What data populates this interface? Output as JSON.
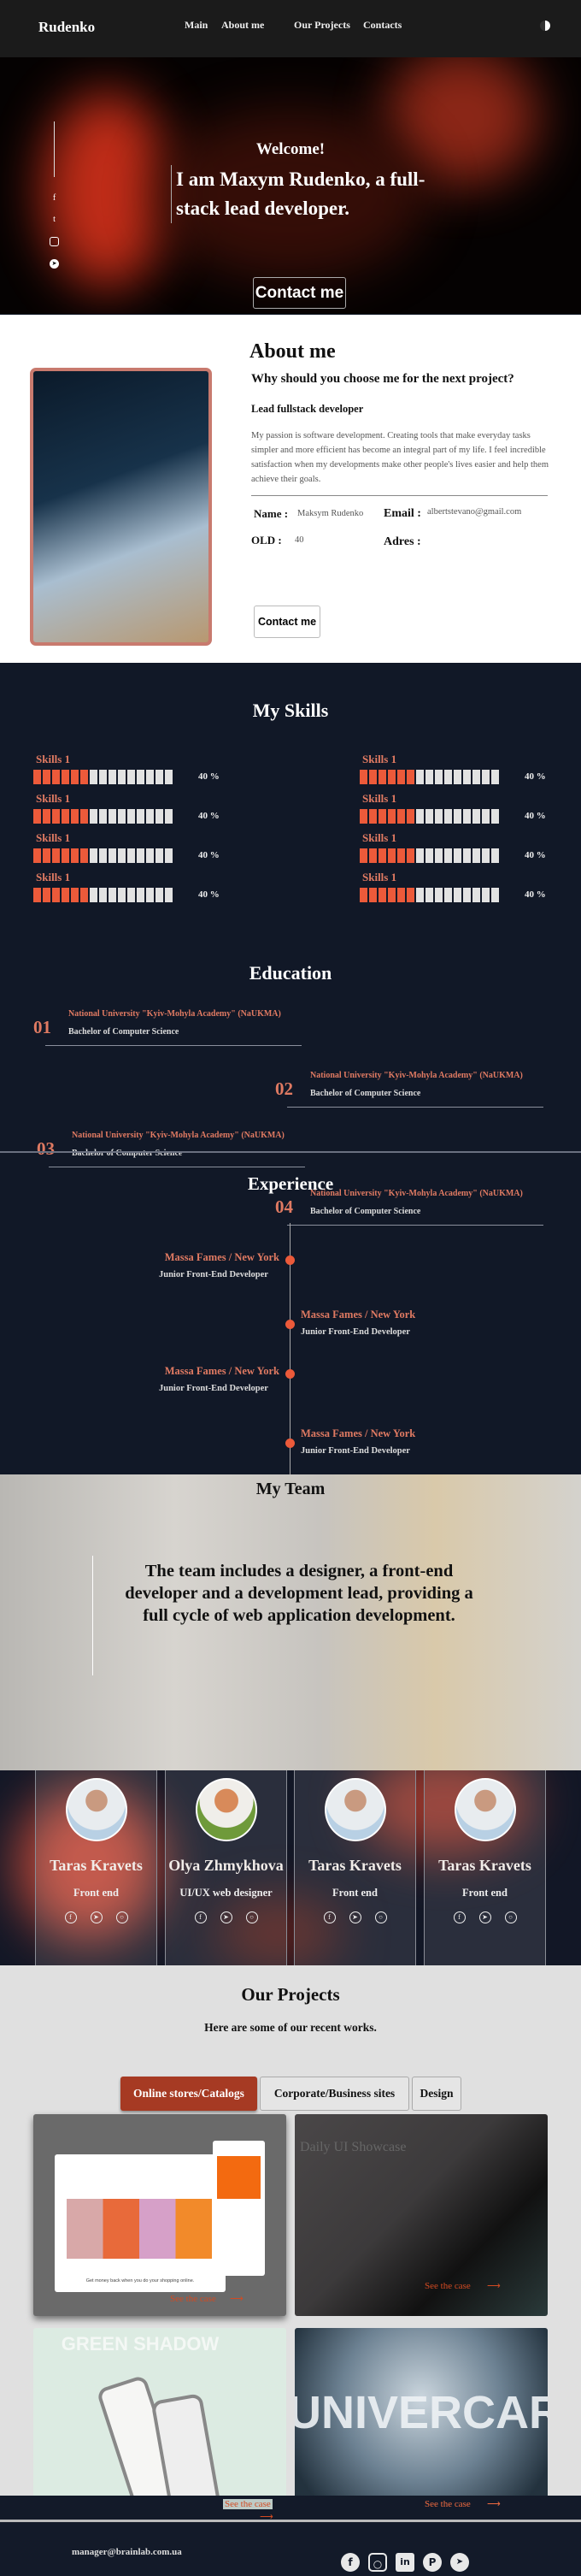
{
  "header": {
    "logo": "Rudenko",
    "nav": [
      "Main",
      "About me",
      "Our Projects",
      "Contacts"
    ],
    "theme_icon": "half-moon-toggle"
  },
  "hero": {
    "welcome": "Welcome!",
    "headline": "I am Maxym Rudenko, a full-stack lead developer.",
    "button": "Contact me",
    "socials": [
      "facebook",
      "twitter",
      "instagram",
      "telegram"
    ],
    "accent": "#e8381f"
  },
  "about": {
    "title": "About me",
    "question": "Why should you choose me for the next project?",
    "role": "Lead fullstack developer",
    "description": "My passion is software development. Creating tools that make everyday tasks simpler and more efficient has become an integral part of my life. I feel incredible satisfaction when my developments make other people's lives easier and help them achieve their goals.",
    "name_label": "Name :",
    "name": "Maksym Rudenko",
    "email_label": "Email :",
    "email": "albertstevano@gmail.com",
    "old_label": "OLD :",
    "old": "40",
    "address_label": "Adres :",
    "button": "Contact me"
  },
  "skills": {
    "title": "My Skills",
    "items": [
      {
        "label": "Skills 1",
        "percent": 40,
        "text": "40 %"
      },
      {
        "label": "Skills 1",
        "percent": 40,
        "text": "40 %"
      },
      {
        "label": "Skills 1",
        "percent": 40,
        "text": "40 %"
      },
      {
        "label": "Skills 1",
        "percent": 40,
        "text": "40 %"
      },
      {
        "label": "Skills 1",
        "percent": 40,
        "text": "40 %"
      },
      {
        "label": "Skills 1",
        "percent": 40,
        "text": "40 %"
      },
      {
        "label": "Skills 1",
        "percent": 40,
        "text": "40 %"
      },
      {
        "label": "Skills 1",
        "percent": 40,
        "text": "40 %"
      }
    ],
    "fill_color": "#ec5a3a",
    "empty_color": "#e2e2e2"
  },
  "education": {
    "title": "Education",
    "items": [
      {
        "num": "01",
        "school": "National University \"Kyiv-Mohyla Academy\" (NaUKMA)",
        "degree": "Bachelor of Computer Science"
      },
      {
        "num": "02",
        "school": "National University \"Kyiv-Mohyla Academy\" (NaUKMA)",
        "degree": "Bachelor of Computer Science"
      },
      {
        "num": "03",
        "school": "National University \"Kyiv-Mohyla Academy\" (NaUKMA)",
        "degree": "Bachelor of Computer Science"
      },
      {
        "num": "04",
        "school": "National University \"Kyiv-Mohyla Academy\" (NaUKMA)",
        "degree": "Bachelor of Computer Science"
      }
    ]
  },
  "experience": {
    "title": "Experience",
    "items": [
      {
        "company": "Massa Fames / New York",
        "role": "Junior Front-End Developer"
      },
      {
        "company": "Massa Fames / New York",
        "role": "Junior Front-End Developer"
      },
      {
        "company": "Massa Fames / New York",
        "role": "Junior Front-End Developer"
      },
      {
        "company": "Massa Fames / New York",
        "role": "Junior Front-End Developer"
      }
    ]
  },
  "team": {
    "title": "My Team",
    "text": "The team includes a designer, a front-end developer and a development lead, providing a full cycle of web application development.",
    "members": [
      {
        "name": "Taras Kravets",
        "role": "Front end"
      },
      {
        "name": "Olya Zhmykhova",
        "role": "UI/UX web designer"
      },
      {
        "name": "Taras Kravets",
        "role": "Front end"
      },
      {
        "name": "Taras Kravets",
        "role": "Front end"
      }
    ],
    "member_socials": [
      "facebook",
      "telegram",
      "instagram"
    ]
  },
  "projects": {
    "title": "Our Projects",
    "subtitle": "Here are some of our recent works.",
    "tabs": [
      "Online stores/Catalogs",
      "Corporate/Business sites",
      "Design"
    ],
    "active_tab": "Online stores/Catalogs",
    "items": [
      {
        "caption": "Get money back when you do your shopping online.",
        "link": "See the case"
      },
      {
        "heading": "Daily UI Showcase",
        "link": "See the case"
      },
      {
        "heading": "GREEN SHADOW",
        "link": "See the case"
      },
      {
        "heading": "UNIVERCAR",
        "link": "See the case"
      }
    ]
  },
  "footer": {
    "email": "manager@brainlab.com.ua",
    "socials": [
      "facebook",
      "instagram",
      "linkedin",
      "pinterest",
      "telegram"
    ]
  }
}
